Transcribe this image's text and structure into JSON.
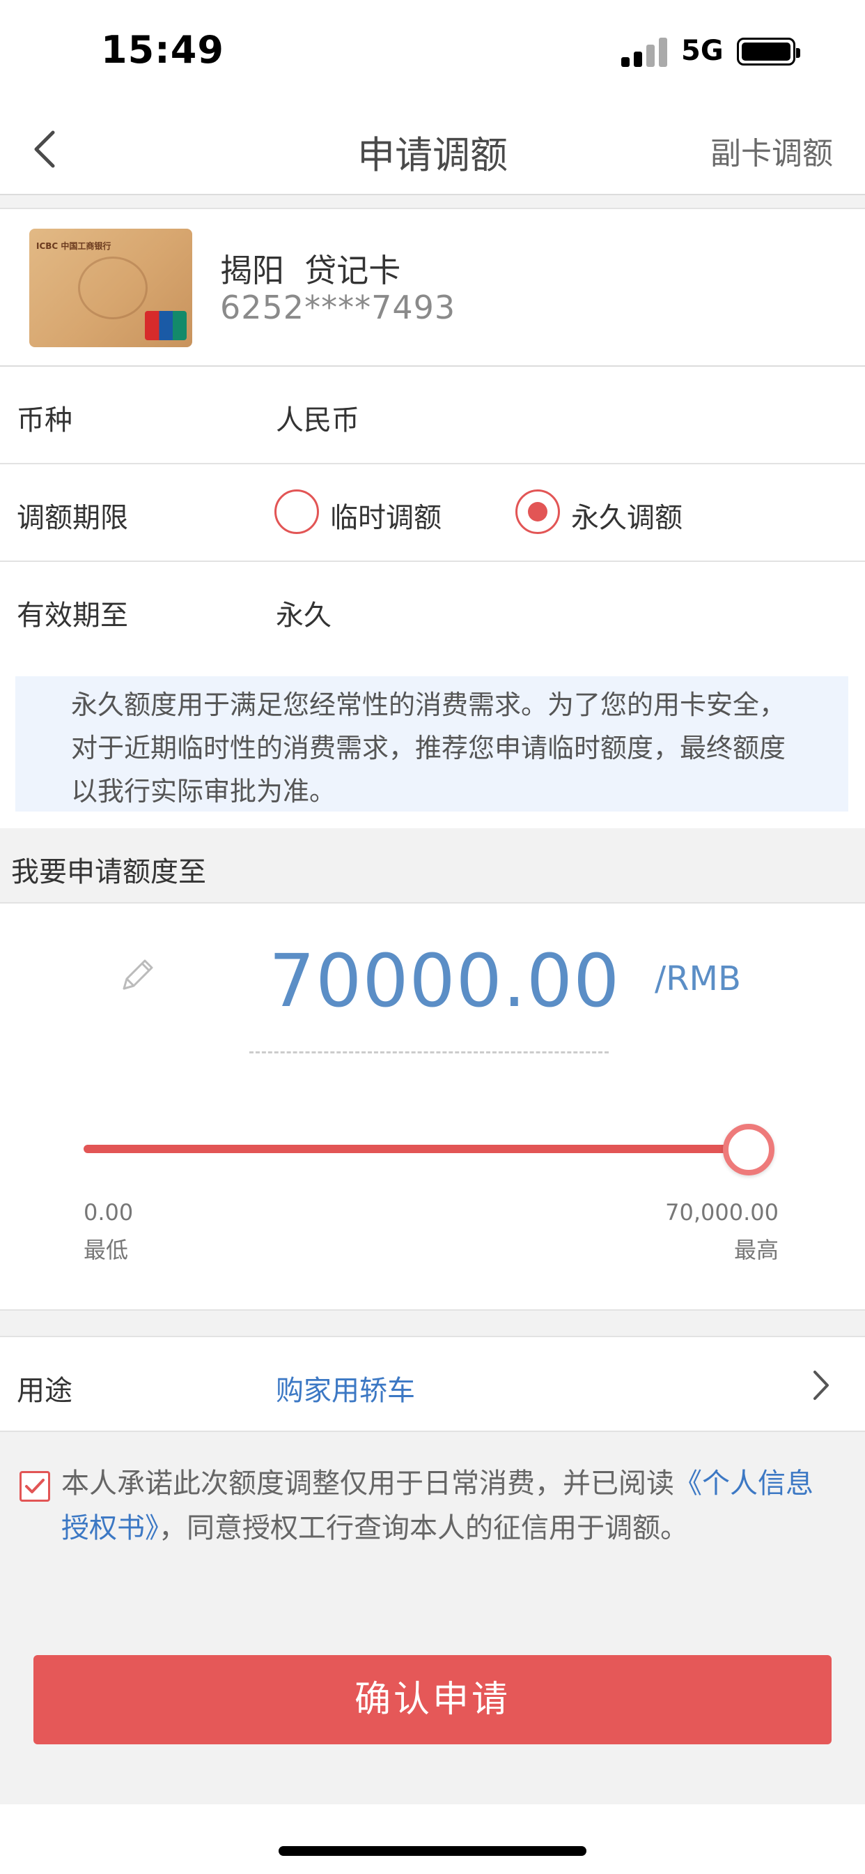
{
  "status_bar": {
    "time": "15:49",
    "network": "5G"
  },
  "nav": {
    "title": "申请调额",
    "right_action": "副卡调额"
  },
  "card": {
    "name": "揭阳  贷记卡",
    "number": "6252****7493",
    "image_text": "ICBC 中国工商银行"
  },
  "currency": {
    "label": "币种",
    "value": "人民币"
  },
  "period": {
    "label": "调额期限",
    "options": [
      {
        "label": "临时调额",
        "selected": false
      },
      {
        "label": "永久调额",
        "selected": true
      }
    ]
  },
  "valid_until": {
    "label": "有效期至",
    "value": "永久"
  },
  "notice": "永久额度用于满足您经常性的消费需求。为了您的用卡安全，对于近期临时性的消费需求，推荐您申请临时额度，最终额度以我行实际审批为准。",
  "amount_section": {
    "header": "我要申请额度至",
    "amount": "70000.00",
    "unit": "/RMB",
    "slider": {
      "min_value": "0.00",
      "min_label": "最低",
      "max_value": "70,000.00",
      "max_label": "最高",
      "position_fraction": 1.0
    }
  },
  "purpose": {
    "label": "用途",
    "value": "购家用轿车"
  },
  "agreement": {
    "checked": true,
    "text_before": "本人承诺此次额度调整仅用于日常消费，并已阅读",
    "link": "《个人信息授权书》",
    "text_after": "，同意授权工行查询本人的征信用于调额。"
  },
  "confirm_button": "确认申请",
  "colors": {
    "accent_red": "#e55858",
    "link_blue": "#3c78c4",
    "amount_blue": "#5b8ec6",
    "notice_bg": "#eef4fd"
  }
}
